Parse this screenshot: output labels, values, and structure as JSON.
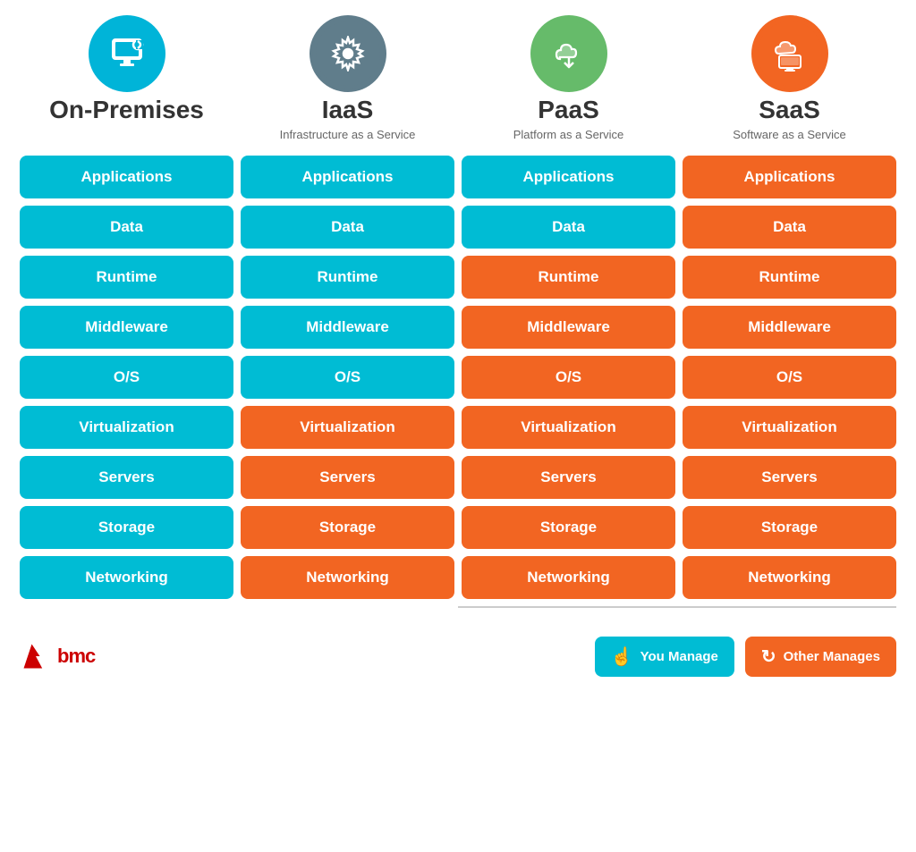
{
  "header": {
    "columns": [
      {
        "id": "on-premises",
        "icon_type": "blue",
        "title": "On-Premises",
        "subtitle": "",
        "icon": "monitor"
      },
      {
        "id": "iaas",
        "icon_type": "gray",
        "title": "IaaS",
        "subtitle": "Infrastructure as a Service",
        "icon": "gear"
      },
      {
        "id": "paas",
        "icon_type": "green",
        "title": "PaaS",
        "subtitle": "Platform as a Service",
        "icon": "cloud-download"
      },
      {
        "id": "saas",
        "icon_type": "orange",
        "title": "SaaS",
        "subtitle": "Software as a Service",
        "icon": "cloud-monitor"
      }
    ]
  },
  "rows": [
    {
      "label": "Applications",
      "colors": [
        "cyan",
        "cyan",
        "cyan",
        "orange"
      ]
    },
    {
      "label": "Data",
      "colors": [
        "cyan",
        "cyan",
        "cyan",
        "orange"
      ]
    },
    {
      "label": "Runtime",
      "colors": [
        "cyan",
        "cyan",
        "orange",
        "orange"
      ]
    },
    {
      "label": "Middleware",
      "colors": [
        "cyan",
        "cyan",
        "orange",
        "orange"
      ]
    },
    {
      "label": "O/S",
      "colors": [
        "cyan",
        "cyan",
        "orange",
        "orange"
      ]
    },
    {
      "label": "Virtualization",
      "colors": [
        "cyan",
        "orange",
        "orange",
        "orange"
      ]
    },
    {
      "label": "Servers",
      "colors": [
        "cyan",
        "orange",
        "orange",
        "orange"
      ]
    },
    {
      "label": "Storage",
      "colors": [
        "cyan",
        "orange",
        "orange",
        "orange"
      ]
    },
    {
      "label": "Networking",
      "colors": [
        "cyan",
        "orange",
        "orange",
        "orange"
      ]
    }
  ],
  "legend": {
    "you_manage": "You Manage",
    "other_manages": "Other Manages"
  },
  "bmc": {
    "text": "bmc"
  }
}
